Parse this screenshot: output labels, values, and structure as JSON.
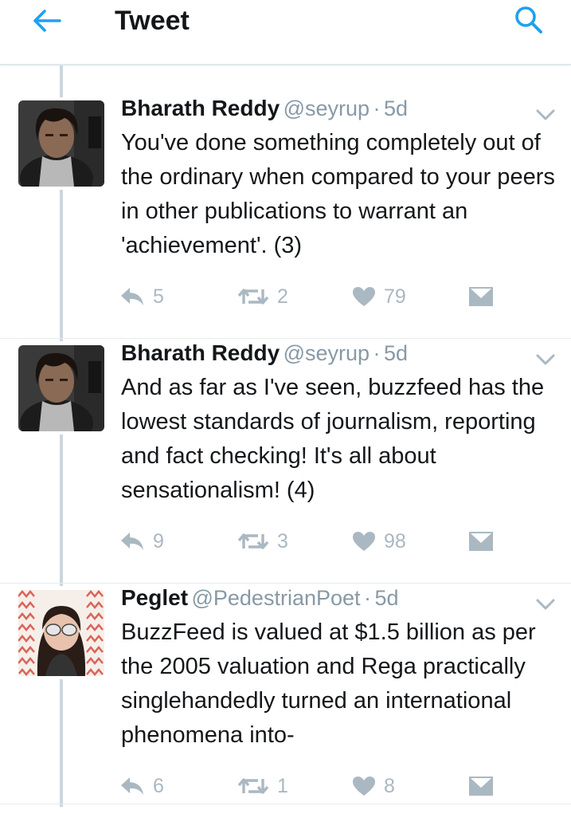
{
  "header": {
    "title": "Tweet",
    "back_icon": "arrow-left-icon",
    "search_icon": "search-icon",
    "accent_color": "#1da1f2"
  },
  "tweets": [
    {
      "name": "Bharath Reddy",
      "handle": "@seyrup",
      "dot": "·",
      "time": "5d",
      "text": "You've done something completely out of the ordinary when compared to your peers in other publications to warrant an 'achievement'. (3)",
      "replies": "5",
      "retweets": "2",
      "likes": "79"
    },
    {
      "name": "Bharath Reddy",
      "handle": "@seyrup",
      "dot": "·",
      "time": "5d",
      "text": "And as far as I've seen, buzzfeed has the lowest standards of journalism, reporting and fact checking! It's all about sensationalism! (4)",
      "replies": "9",
      "retweets": "3",
      "likes": "98"
    },
    {
      "name": "Peglet",
      "handle": "@PedestrianPoet",
      "dot": "·",
      "time": "5d",
      "text": "BuzzFeed is valued at $1.5 billion as per the 2005 valuation and Rega practically singlehandedly turned an international phenomena into-",
      "replies": "6",
      "retweets": "1",
      "likes": "8"
    }
  ]
}
